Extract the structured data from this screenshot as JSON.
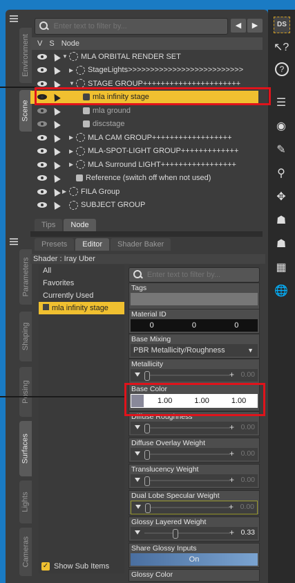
{
  "scene_panel": {
    "filter_placeholder": "Enter text to filter by...",
    "headers": {
      "v": "V",
      "s": "S",
      "node": "Node"
    },
    "nodes": [
      {
        "label": "MLA ORBITAL RENDER SET",
        "expander": "▼",
        "icon": "group-icon"
      },
      {
        "label": "StageLights>>>>>>>>>>>>>>>>>>>>>>>>>>",
        "expander": "▶",
        "icon": "group-icon"
      },
      {
        "label": "STAGE GROUP++++++++++++++++++++++",
        "expander": "▼",
        "icon": "group-icon"
      },
      {
        "label": "mla infinity stage",
        "expander": "",
        "icon": "cube-icon",
        "selected": true
      },
      {
        "label": "mla ground",
        "expander": "",
        "icon": "cube-icon",
        "hidden": true
      },
      {
        "label": "discstage",
        "expander": "",
        "icon": "cube-icon",
        "hidden": true
      },
      {
        "label": "MLA CAM GROUP++++++++++++++++++",
        "expander": "▶",
        "icon": "group-icon"
      },
      {
        "label": "MLA-SPOT-LIGHT GROUP+++++++++++++",
        "expander": "▶",
        "icon": "group-icon"
      },
      {
        "label": "MLA Surround LIGHT+++++++++++++++++",
        "expander": "▶",
        "icon": "group-icon"
      },
      {
        "label": "Reference (switch off when not used)",
        "expander": "",
        "icon": "cube-icon"
      },
      {
        "label": "FILA Group",
        "expander": "▶",
        "icon": "group-icon"
      },
      {
        "label": "SUBJECT GROUP",
        "expander": "",
        "icon": "group-icon"
      }
    ],
    "bottom_tabs": [
      "Tips",
      "Node"
    ]
  },
  "left_tabs_top": [
    "Environment",
    "Scene"
  ],
  "left_tabs_bottom": [
    "Parameters",
    "Shaping",
    "Posing",
    "Surfaces",
    "Lights",
    "Cameras"
  ],
  "surfaces_panel": {
    "tabs": [
      "Presets",
      "Editor",
      "Shader Baker"
    ],
    "shader_label": "Shader : Iray Uber",
    "categories": [
      "All",
      "Favorites",
      "Currently Used",
      "mla infinity stage"
    ],
    "filter_placeholder": "Enter text to filter by...",
    "properties": {
      "tags": "Tags",
      "material_id": {
        "title": "Material ID",
        "values": [
          "0",
          "0",
          "0"
        ]
      },
      "base_mixing": {
        "title": "Base Mixing",
        "value": "PBR Metallicity/Roughness"
      },
      "metallicity": {
        "title": "Metallicity",
        "value": "0.00"
      },
      "base_color": {
        "title": "Base Color",
        "values": [
          "1.00",
          "1.00",
          "1.00"
        ]
      },
      "diffuse_roughness": {
        "title": "Diffuse Roughness",
        "value": "0.00"
      },
      "diffuse_overlay": {
        "title": "Diffuse Overlay Weight",
        "value": "0.00"
      },
      "translucency": {
        "title": "Translucency Weight",
        "value": "0.00"
      },
      "dual_lobe": {
        "title": "Dual Lobe Specular Weight",
        "value": "0.00"
      },
      "glossy_layered": {
        "title": "Glossy Layered Weight",
        "value": "0.33",
        "fraction": 0.33
      },
      "share_glossy": {
        "title": "Share Glossy Inputs",
        "value": "On"
      },
      "glossy_color": {
        "title": "Glossy Color"
      }
    },
    "show_sub_items": "Show Sub Items"
  },
  "right_toolbar": {
    "logo": "DS"
  }
}
